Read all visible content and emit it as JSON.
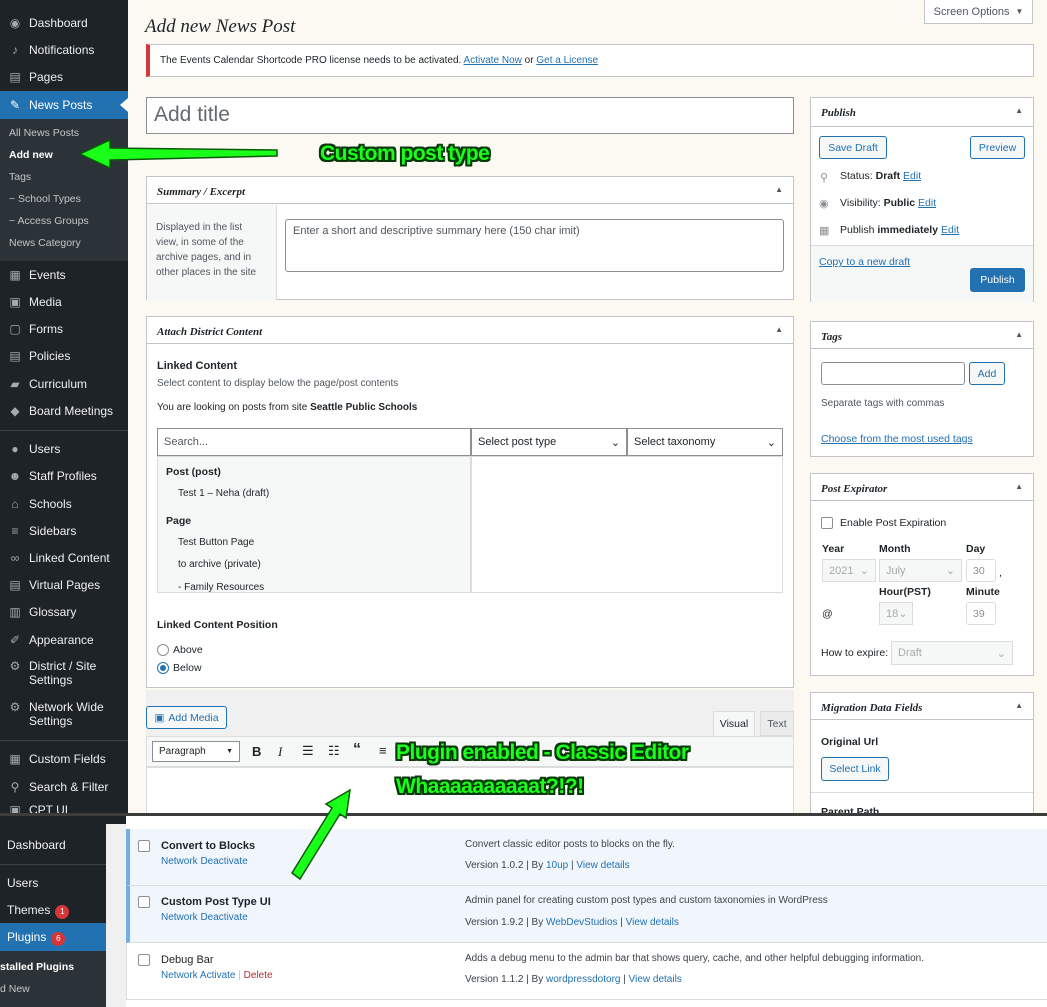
{
  "sidebar": {
    "items": [
      {
        "label": "Dashboard",
        "icon": "dashboard-icon"
      },
      {
        "label": "Notifications",
        "icon": "bell-icon"
      },
      {
        "label": "Pages",
        "icon": "pages-icon"
      },
      {
        "label": "News Posts",
        "icon": "pin-icon"
      },
      {
        "label": "Events",
        "icon": "calendar-icon"
      },
      {
        "label": "Media",
        "icon": "media-icon"
      },
      {
        "label": "Forms",
        "icon": "forms-icon"
      },
      {
        "label": "Policies",
        "icon": "policies-icon"
      },
      {
        "label": "Curriculum",
        "icon": "folder-icon"
      },
      {
        "label": "Board Meetings",
        "icon": "tag-icon"
      },
      {
        "label": "Users",
        "icon": "users-icon"
      },
      {
        "label": "Staff Profiles",
        "icon": "staff-icon"
      },
      {
        "label": "Schools",
        "icon": "home-icon"
      },
      {
        "label": "Sidebars",
        "icon": "sidebars-icon"
      },
      {
        "label": "Linked Content",
        "icon": "link-icon"
      },
      {
        "label": "Virtual Pages",
        "icon": "page-icon"
      },
      {
        "label": "Glossary",
        "icon": "glossary-icon"
      },
      {
        "label": "Appearance",
        "icon": "brush-icon"
      },
      {
        "label": "District / Site",
        "label2": "Settings",
        "icon": "gear-icon"
      },
      {
        "label": "Network Wide",
        "label2": "Settings",
        "icon": "gear-icon"
      },
      {
        "label": "Custom Fields",
        "icon": "fields-icon"
      },
      {
        "label": "Search & Filter",
        "icon": "search-icon"
      },
      {
        "label": "CPT UI",
        "icon": "cpt-icon"
      }
    ],
    "submenu": [
      "All News Posts",
      "Add new",
      "Tags",
      "~ School Types",
      "~ Access Groups",
      "News Category"
    ]
  },
  "page": {
    "title": "Add new News Post",
    "screen_options": "Screen Options",
    "notice": {
      "text": "The Events Calendar Shortcode PRO license needs to be activated.",
      "link1": "Activate Now",
      "or": "or",
      "link2": "Get a License"
    },
    "title_placeholder": "Add title"
  },
  "summary_box": {
    "title": "Summary / Excerpt",
    "description": [
      "Displayed in the list",
      "view, in some of the",
      "archive pages, and in",
      "other places in the site"
    ],
    "placeholder": "Enter a short and descriptive summary here (150 char imit)"
  },
  "district_box": {
    "title": "Attach District Content",
    "linked_heading": "Linked Content",
    "linked_desc": "Select content to display below the page/post contents",
    "looking_prefix": "You are looking on posts from site",
    "site": "Seattle Public Schools",
    "search_placeholder": "Search...",
    "post_type": "Select post type",
    "taxonomy": "Select taxonomy",
    "results": [
      {
        "text": "Post (post)",
        "group": true
      },
      {
        "text": "Test 1 – Neha (draft)",
        "group": false
      },
      {
        "text": "Page",
        "group": true
      },
      {
        "text": "Test Button Page",
        "group": false
      },
      {
        "text": "to archive (private)",
        "group": false
      },
      {
        "text": "- Family Resources",
        "group": false
      }
    ],
    "position_heading": "Linked Content Position",
    "above": "Above",
    "below": "Below"
  },
  "editor": {
    "add_media": "Add Media",
    "tab_visual": "Visual",
    "tab_text": "Text",
    "format": "Paragraph"
  },
  "publish_box": {
    "title": "Publish",
    "save_draft": "Save Draft",
    "preview": "Preview",
    "status_label": "Status:",
    "status_value": "Draft",
    "visibility_label": "Visibility:",
    "visibility_value": "Public",
    "publish_label": "Publish",
    "publish_value": "immediately",
    "edit": "Edit",
    "copy": "Copy to a new draft",
    "publish_btn": "Publish"
  },
  "tags_box": {
    "title": "Tags",
    "add": "Add",
    "hint": "Separate tags with commas",
    "choose": "Choose from the most used tags"
  },
  "expirator_box": {
    "title": "Post Expirator",
    "enable": "Enable Post Expiration",
    "year_label": "Year",
    "month_label": "Month",
    "day_label": "Day",
    "year": "2021",
    "month": "July",
    "day": "30",
    "comma": ",",
    "at": "@",
    "hour_label": "Hour(PST)",
    "minute_label": "Minute",
    "hour": "18",
    "minute": "39",
    "how_label": "How to expire:",
    "how_value": "Draft"
  },
  "migration_box": {
    "title": "Migration Data Fields",
    "original_url": "Original Url",
    "select_link": "Select Link",
    "parent_path": "Parent Path"
  },
  "annotations": {
    "custom_post_type": "Custom post type",
    "plugin_line1": "Plugin enabled - Classic Editor",
    "plugin_line2": "Whaaaaaaaaaat?!?!"
  },
  "bottom": {
    "sidebar": [
      {
        "label": "Dashboard"
      },
      {
        "label": "Users"
      },
      {
        "label": "Themes",
        "badge": "1"
      },
      {
        "label": "Plugins",
        "badge": "6"
      },
      {
        "label": "stalled Plugins"
      },
      {
        "label": "d New"
      }
    ],
    "plugins": [
      {
        "name": "Convert to Blocks",
        "action1": "Network Deactivate",
        "action2": "",
        "desc": "Convert classic editor posts to blocks on the fly.",
        "version": "Version 1.0.2 | By",
        "author": "10up",
        "details": "View details"
      },
      {
        "name": "Custom Post Type UI",
        "action1": "Network Deactivate",
        "action2": "",
        "desc": "Admin panel for creating custom post types and custom taxonomies in WordPress",
        "version": "Version 1.9.2 | By",
        "author": "WebDevStudios",
        "details": "View details"
      },
      {
        "name": "Debug Bar",
        "action1": "Network Activate",
        "action2": "Delete",
        "desc": "Adds a debug menu to the admin bar that shows query, cache, and other helpful debugging information.",
        "version": "Version 1.1.2 | By",
        "author": "wordpressdotorg",
        "details": "View details"
      }
    ]
  }
}
